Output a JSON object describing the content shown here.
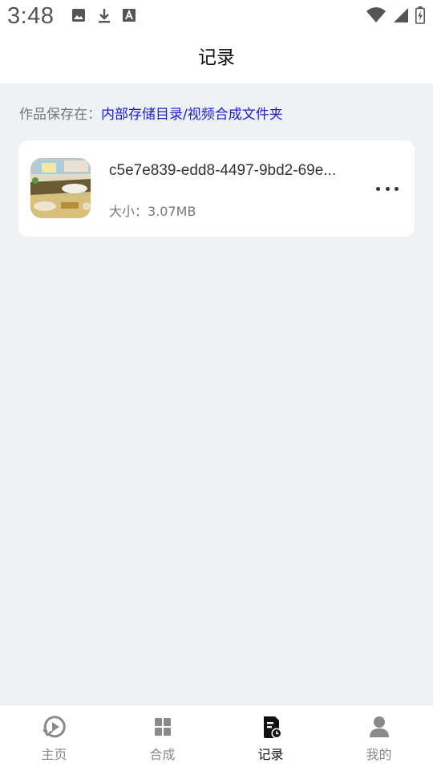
{
  "status_bar": {
    "time": "3:48",
    "left_icons": [
      "image-icon",
      "download-icon",
      "font-icon"
    ],
    "right_icons": [
      "wifi-icon",
      "cell-signal-icon",
      "battery-charging-icon"
    ]
  },
  "header": {
    "title": "记录"
  },
  "save_location": {
    "label": "作品保存在：",
    "path": "内部存储目录/视频合成文件夹",
    "path_color": "#1a1adb"
  },
  "records": [
    {
      "file_name": "c5e7e839-edd8-4497-9bd2-69e...",
      "size_label": "大小：",
      "size_value": "3.07MB",
      "thumbnail_icon": "video-thumbnail",
      "more_icon": "more-dots-icon"
    }
  ],
  "tabs": [
    {
      "label": "主页",
      "icon": "play-circle-icon",
      "active": false
    },
    {
      "label": "合成",
      "icon": "grid-icon",
      "active": false
    },
    {
      "label": "记录",
      "icon": "record-doc-icon",
      "active": true
    },
    {
      "label": "我的",
      "icon": "person-icon",
      "active": false
    }
  ],
  "colors": {
    "background": "#eff2f5",
    "active_tab": "#111111",
    "inactive_tab": "#888888"
  }
}
